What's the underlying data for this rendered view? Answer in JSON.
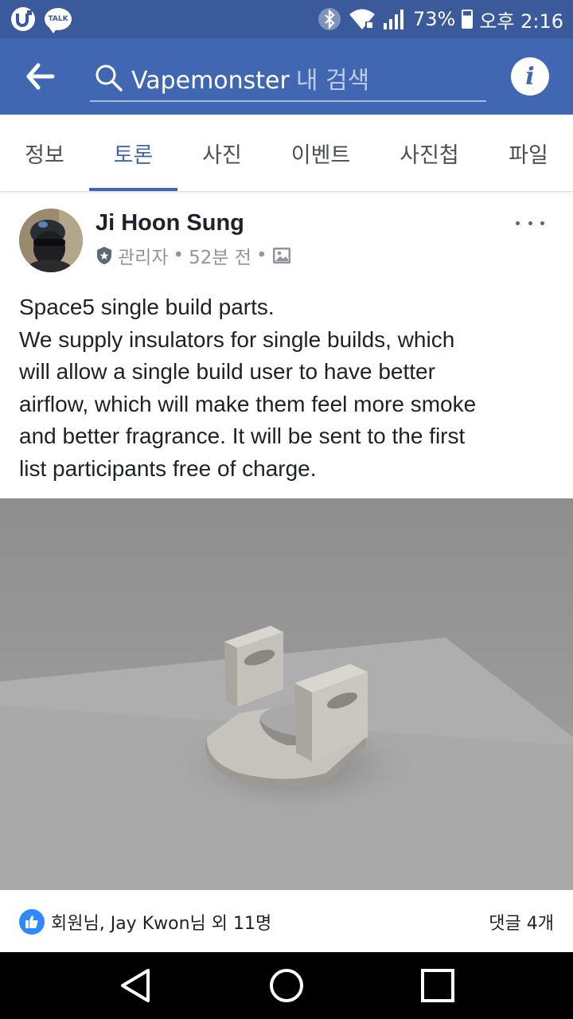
{
  "status_bar": {
    "talk_label": "TALK",
    "battery": "73%",
    "time": "오후 2:16",
    "battery_level": 0.73
  },
  "app_bar": {
    "search_query": "Vapemonster",
    "search_suffix": "내 검색",
    "info_glyph": "i"
  },
  "tabs": [
    {
      "label": "정보",
      "active": false
    },
    {
      "label": "토론",
      "active": true
    },
    {
      "label": "사진",
      "active": false
    },
    {
      "label": "이벤트",
      "active": false
    },
    {
      "label": "사진첩",
      "active": false
    },
    {
      "label": "파일",
      "active": false
    }
  ],
  "post": {
    "author": "Ji Hoon Sung",
    "role": "관리자",
    "time_ago": "52분 전",
    "separator": "•",
    "body_lines": [
      "Space5 single build parts.",
      "We supply insulators for single builds, which",
      "will allow a single build user to have better",
      "airflow, which will make them feel more smoke",
      "and better fragrance. It will be sent to the first",
      "list participants free of charge."
    ],
    "reactions_text": "회원님, Jay Kwon님 외 11명",
    "comments_text": "댓글 4개"
  },
  "colors": {
    "brand": "#4267b2",
    "status_bar": "#3a5a9c",
    "like_blue": "#2e89ff"
  },
  "icons": [
    "back-arrow-icon",
    "search-icon",
    "info-icon",
    "more-icon",
    "shield-icon",
    "photo-icon",
    "like-icon",
    "back-nav-icon",
    "home-nav-icon",
    "recents-nav-icon"
  ]
}
